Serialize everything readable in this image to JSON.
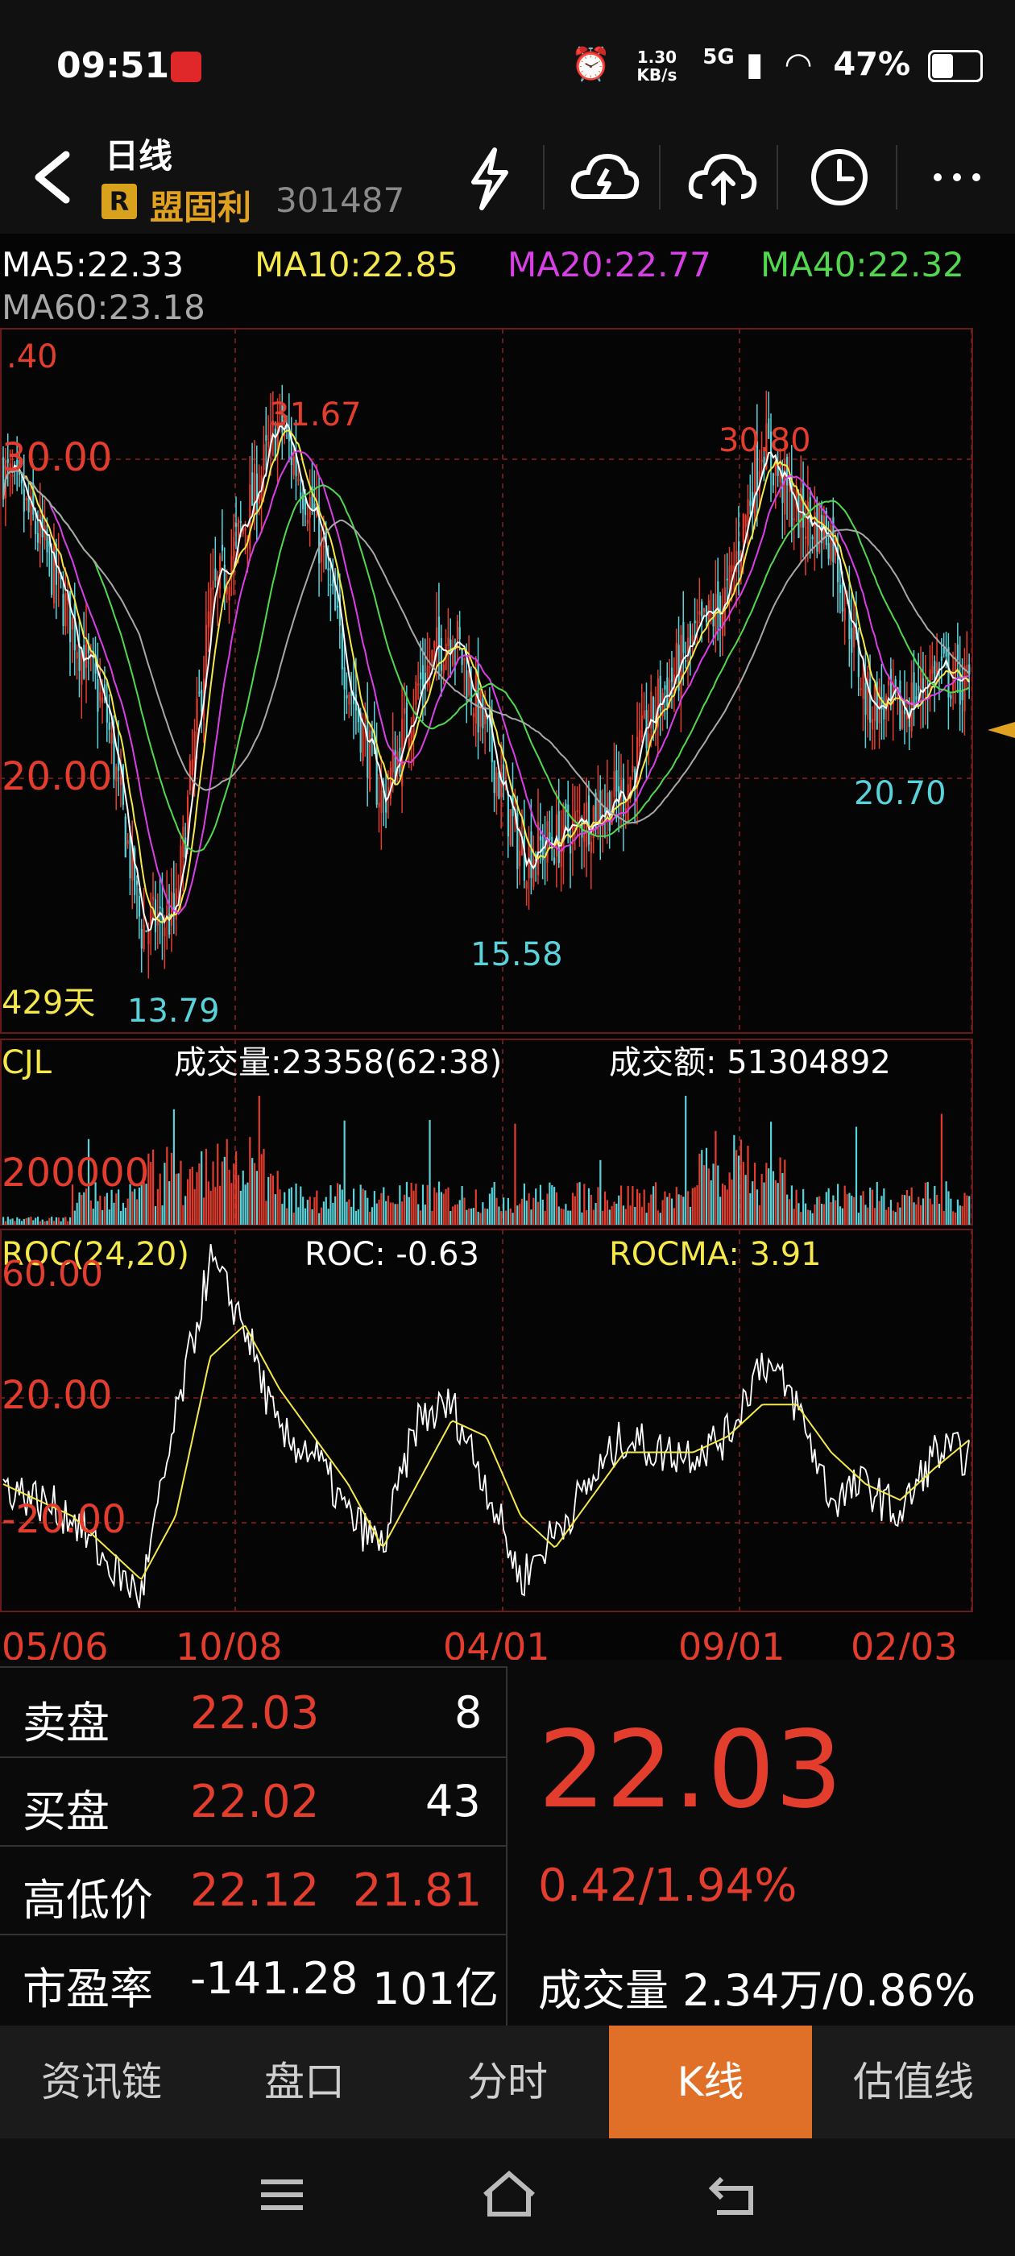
{
  "status": {
    "time": "09:51",
    "net_speed_top": "1.30",
    "net_speed_bottom": "KB/s",
    "network": "5G",
    "battery": "47%"
  },
  "header": {
    "period": "日线",
    "badge": "R",
    "stock_name": "盟固利",
    "stock_code": "301487"
  },
  "ma": {
    "ma5": "MA5:22.33",
    "ma10": "MA10:22.85",
    "ma20": "MA20:22.77",
    "ma40": "MA40:22.32",
    "ma60": "MA60:23.18"
  },
  "price_chart": {
    "axis_labels": [
      ".40",
      "30.00",
      "20.00"
    ],
    "annotations": {
      "high1": "31.67",
      "high2": "30.80",
      "low1": "13.79",
      "low2": "15.58",
      "low3": "20.70",
      "days": "429天"
    }
  },
  "volume_chart": {
    "title": "CJL",
    "volume": "成交量:23358(62:38)",
    "amount": "成交额: 51304892",
    "axis_label": "200000"
  },
  "roc_chart": {
    "title": "ROC(24,20)",
    "roc": "ROC: -0.63",
    "rocma": "ROCMA: 3.91",
    "axis_labels": [
      "60.00",
      "20.00",
      "-20.00"
    ]
  },
  "x_axis": [
    "05/06",
    "10/08",
    "04/01",
    "09/01",
    "02/03"
  ],
  "chart_data": [
    {
      "type": "line",
      "title": "",
      "series": [
        {
          "name": "MA5",
          "values": [
            28.2,
            26.5,
            24.0,
            21.5,
            15.8,
            16.2,
            24.5,
            26.8,
            29.5,
            27.0,
            22.5,
            19.2,
            22.3,
            24.0,
            21.0,
            17.8,
            18.2,
            18.9,
            19.5,
            22.0,
            23.5,
            24.8,
            29.0,
            27.0,
            26.5,
            22.0,
            21.6,
            22.8,
            22.33
          ]
        }
      ],
      "categories": [
        "05/06",
        "",
        "",
        "",
        "",
        "",
        "10/08",
        "",
        "",
        "",
        "",
        "",
        "",
        "04/01",
        "",
        "",
        "",
        "",
        "",
        "",
        "09/01",
        "",
        "",
        "",
        "",
        "",
        "02/03",
        "",
        ""
      ],
      "ylim": [
        13.0,
        32.0
      ]
    },
    {
      "type": "line",
      "title": "ROC(24,20)",
      "series": [
        {
          "name": "ROC",
          "values": [
            -10,
            -15,
            -20,
            -35,
            -45,
            10,
            60,
            40,
            5,
            0,
            -20,
            -30,
            10,
            15,
            -10,
            -40,
            -25,
            -10,
            5,
            0,
            0,
            5,
            30,
            15,
            -15,
            -10,
            -20,
            0,
            -0.63
          ]
        },
        {
          "name": "ROCMA",
          "values": [
            -10,
            -15,
            -20,
            -30,
            -40,
            -20,
            30,
            40,
            20,
            5,
            -10,
            -30,
            -10,
            10,
            5,
            -20,
            -30,
            -15,
            0,
            0,
            0,
            5,
            15,
            15,
            0,
            -10,
            -15,
            -5,
            3.91
          ]
        }
      ],
      "ylim": [
        -50,
        70
      ]
    }
  ],
  "quote": {
    "sell_label": "卖盘",
    "sell_price": "22.03",
    "sell_qty": "8",
    "buy_label": "买盘",
    "buy_price": "22.02",
    "buy_qty": "43",
    "hl_label": "高低价",
    "high": "22.12",
    "low": "21.81",
    "pe_label": "市盈率",
    "pe": "-141.28",
    "mcap": "101亿",
    "last_price": "22.03",
    "change": "0.42/1.94%",
    "vol_label": "成交量",
    "vol_value": "2.34万/0.86%"
  },
  "tabs": [
    "资讯链",
    "盘口",
    "分时",
    "K线",
    "估值线"
  ],
  "colors": {
    "up": "#e23d2d",
    "down": "#5ad2da",
    "ma5": "#ffffff",
    "ma10": "#f5e84a",
    "ma20": "#d840e6",
    "ma40": "#52d84f",
    "ma60": "#a8a8a8",
    "accent": "#e07028"
  }
}
